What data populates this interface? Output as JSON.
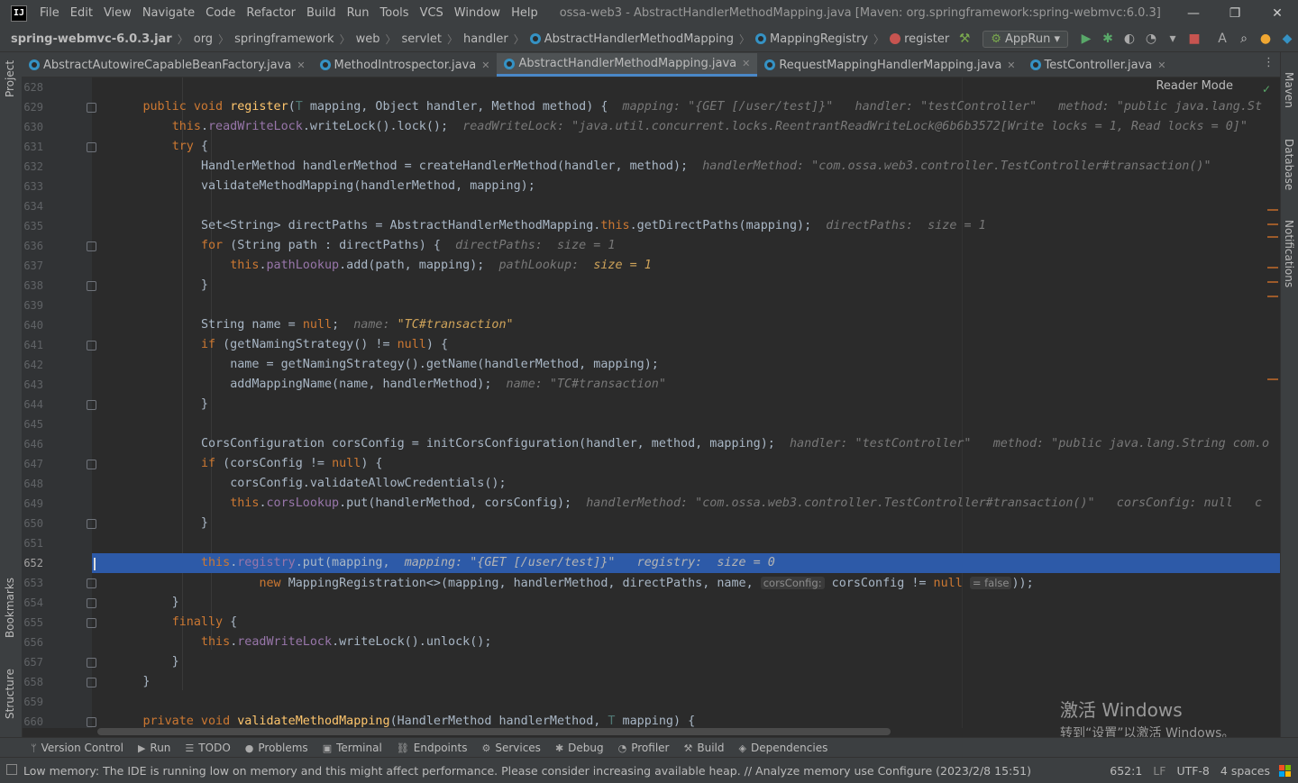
{
  "menu": {
    "items": [
      "File",
      "Edit",
      "View",
      "Navigate",
      "Code",
      "Refactor",
      "Build",
      "Run",
      "Tools",
      "VCS",
      "Window",
      "Help"
    ],
    "window_title": "ossa-web3 - AbstractHandlerMethodMapping.java [Maven: org.springframework:spring-webmvc:6.0.3]"
  },
  "breadcrumb": {
    "root": "spring-webmvc-6.0.3.jar",
    "items": [
      "org",
      "springframework",
      "web",
      "servlet",
      "handler"
    ],
    "class": "AbstractHandlerMethodMapping",
    "inner": "MappingRegistry",
    "method": "register"
  },
  "run_config": "AppRun",
  "tabs": [
    {
      "label": "AbstractAutowireCapableBeanFactory.java",
      "active": false
    },
    {
      "label": "MethodIntrospector.java",
      "active": false
    },
    {
      "label": "AbstractHandlerMethodMapping.java",
      "active": true
    },
    {
      "label": "RequestMappingHandlerMapping.java",
      "active": false
    },
    {
      "label": "TestController.java",
      "active": false
    }
  ],
  "side_left": {
    "project": "Project",
    "bookmarks": "Bookmarks",
    "structure": "Structure"
  },
  "side_right": {
    "maven": "Maven",
    "database": "Database",
    "notifications": "Notifications"
  },
  "reader_mode": "Reader Mode",
  "line_numbers": [
    "628",
    "629",
    "630",
    "631",
    "632",
    "633",
    "634",
    "635",
    "636",
    "637",
    "638",
    "639",
    "640",
    "641",
    "642",
    "643",
    "644",
    "645",
    "646",
    "647",
    "648",
    "649",
    "650",
    "651",
    "652",
    "653",
    "654",
    "655",
    "656",
    "657",
    "658",
    "659",
    "660"
  ],
  "current_line": "652",
  "code": {
    "l629": {
      "a": "public void ",
      "b": "register",
      "c": "(",
      "d": "T",
      " e": "",
      "f": " mapping, Object handler, Method method) {",
      "h1": "mapping: ",
      "h1v": "\"{GET [/user/test]}\"",
      "h2": "handler: ",
      "h2v": "\"testController\"",
      "h3": "method: ",
      "h3v": "\"public java.lang.St"
    },
    "l630": {
      "a": "this",
      "b": ".",
      "c": "readWriteLock",
      ".d": "",
      "e": ".writeLock().lock();",
      "h": "readWriteLock: ",
      "hv": "\"java.util.concurrent.locks.ReentrantReadWriteLock@6b6b3572[Write locks = 1, Read locks = 0]\""
    },
    "l631": {
      "a": "try",
      " b": " {"
    },
    "l632": {
      "a": "HandlerMethod handlerMethod = createHandlerMethod(handler, method);",
      "h": "handlerMethod: ",
      "hv": "\"com.ossa.web3.controller.TestController#transaction()\""
    },
    "l633": {
      "a": "validateMethodMapping(handlerMethod, mapping);"
    },
    "l635": {
      "a": "Set<String> directPaths = AbstractHandlerMethodMapping.",
      "b": "this",
      ".c": ".getDirectPaths(mapping);",
      "h": "directPaths:  size = 1"
    },
    "l636": {
      "a": "for",
      " b": " (String path : directPaths) {",
      "h": "directPaths:  size = 1"
    },
    "l637": {
      "a": "this",
      "b": ".",
      "c": "pathLookup",
      "d": ".add(path, mapping);",
      "h": "pathLookup:  ",
      "hv": "size = 1"
    },
    "l640": {
      "a": "String name = ",
      "b": "null",
      ";": ";",
      "h": "name: ",
      "hv": "\"TC#transaction\""
    },
    "l641": {
      "a": "if",
      " b": " (getNamingStrategy() != ",
      "c": "null",
      ") {": ") {"
    },
    "l642": {
      "a": "name = getNamingStrategy().getName(handlerMethod, mapping);"
    },
    "l643": {
      "a": "addMappingName(name, handlerMethod);",
      "h": "name: \"TC#transaction\""
    },
    "l646": {
      "a": "CorsConfiguration corsConfig = initCorsConfiguration(handler, method, mapping);",
      "h1": "handler: \"testController\"",
      "h2": "method: \"public java.lang.String com.o"
    },
    "l647": {
      "a": "if",
      " b": " (corsConfig != ",
      "c": "null",
      ") {": ") {"
    },
    "l648": {
      "a": "corsConfig.validateAllowCredentials();"
    },
    "l649": {
      "a": "this",
      "b": ".",
      "c": "corsLookup",
      "d": ".put(handlerMethod, corsConfig);",
      "h1": "handlerMethod: \"com.ossa.web3.controller.TestController#transaction()\"",
      "h2": "corsConfig: null",
      "h3": "c"
    },
    "l652": {
      "a": "this",
      "b": ".",
      "c": "registry",
      "d": ".put(mapping,",
      "h1": "mapping: \"{GET [/user/test]}\"",
      "h2": "registry:  size = 0"
    },
    "l653": {
      "a": "new ",
      "b": "MappingRegistration<>(mapping, handlerMethod, directPaths, name, ",
      "inl": "corsConfig:",
      "c": "corsConfig != ",
      "d": "null",
      "inl2": "= false",
      "e": "));"
    },
    "l655": {
      "a": "finally",
      " b": " {"
    },
    "l656": {
      "a": "this",
      "b": ".",
      "c": "readWriteLock",
      "d": ".writeLock().unlock();"
    },
    "l660": {
      "a": "private void ",
      "b": "validateMethodMapping",
      "c": "(HandlerMethod handlerMethod, ",
      "d": "T",
      "e": " mapping) {"
    }
  },
  "tool_windows": [
    "Version Control",
    "Run",
    "TODO",
    "Problems",
    "Terminal",
    "Endpoints",
    "Services",
    "Debug",
    "Profiler",
    "Build",
    "Dependencies"
  ],
  "status": {
    "message": "Low memory: The IDE is running low on memory and this might affect performance. Please consider increasing available heap. // Analyze memory use   Configure (2023/2/8 15:51)",
    "position": "652:1",
    "line_sep": "LF",
    "encoding": "UTF-8",
    "indent": "4 spaces"
  },
  "watermark": {
    "line1": "激活 Windows",
    "line2": "转到“设置”以激活 Windows。"
  },
  "colors": {
    "accent": "#4a88c7",
    "highlight": "#2d5aa8",
    "keyword": "#cc7832",
    "function": "#ffc66d",
    "field": "#9876aa",
    "string": "#6a8759"
  }
}
